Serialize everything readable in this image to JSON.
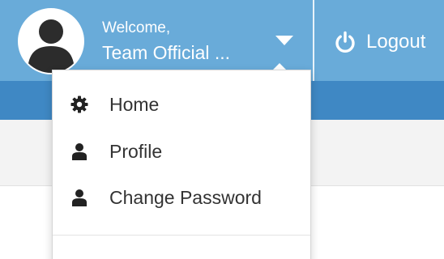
{
  "header": {
    "welcome_text": "Welcome,",
    "username": "Team Official ...",
    "logout_label": "Logout",
    "colors": {
      "topbar": "#69abd9",
      "subbar": "#3f88c4",
      "page": "#f3f3f3"
    }
  },
  "dropdown": {
    "items": [
      {
        "label": "Home",
        "icon": "gear-icon"
      },
      {
        "label": "Profile",
        "icon": "user-icon"
      },
      {
        "label": "Change Password",
        "icon": "user-icon"
      }
    ]
  }
}
